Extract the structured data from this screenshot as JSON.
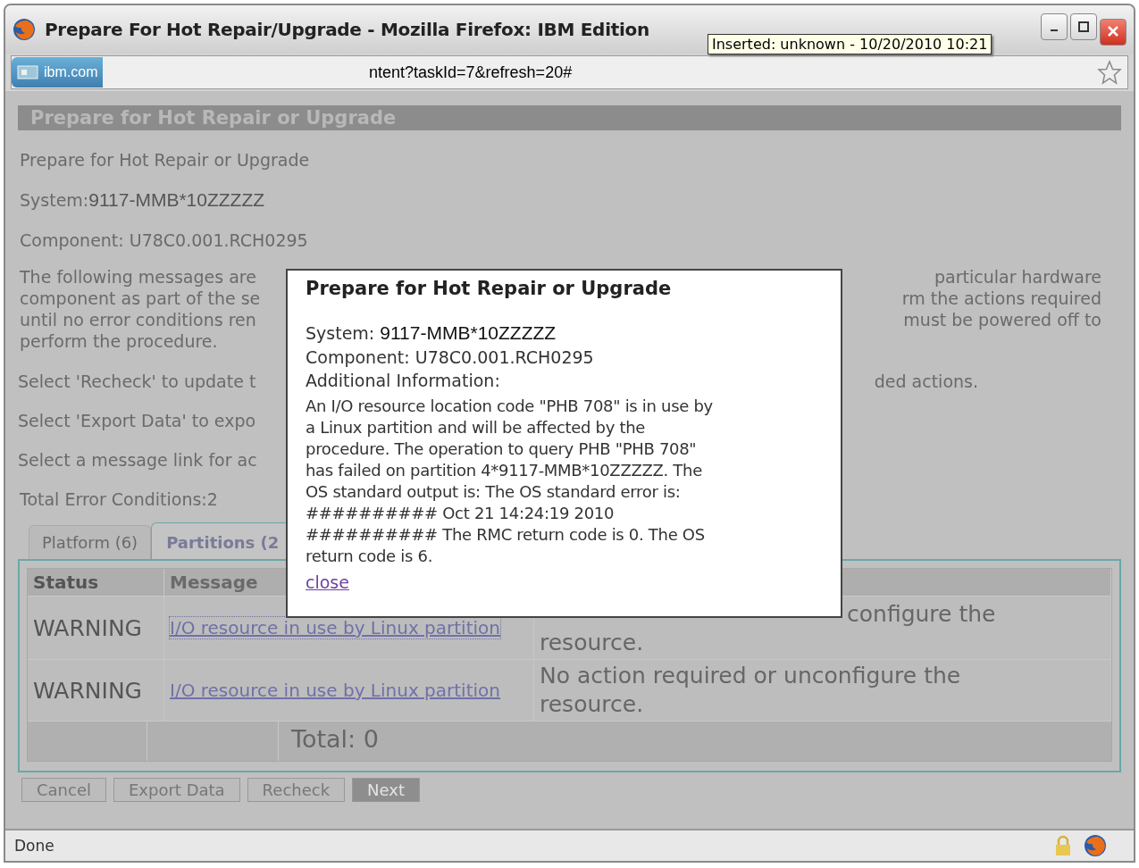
{
  "window": {
    "title": "Prepare For Hot Repair/Upgrade - Mozilla Firefox: IBM Edition",
    "tooltip": "Inserted: unknown - 10/20/2010 10:21"
  },
  "address_bar": {
    "site_badge": "ibm.com",
    "url": "ntent?taskId=7&refresh=20#"
  },
  "page": {
    "banner": "Prepare for Hot Repair or Upgrade",
    "heading": "Prepare for Hot Repair or Upgrade",
    "system_label": "System:",
    "system_value": "9117-MMB*10ZZZZZ",
    "component": "Component: U78C0.001.RCH0295",
    "intro_lines": [
      {
        "left": "The following messages are",
        "right": "particular hardware"
      },
      {
        "left": "component as part of the se",
        "right": "rm the actions required"
      },
      {
        "left": "until no error conditions ren",
        "right": "must be powered off to"
      },
      {
        "left": "perform the procedure."
      }
    ],
    "instructions": [
      {
        "left": "Select 'Recheck' to update t",
        "right": "ded actions."
      },
      {
        "left": "Select 'Export Data' to expo"
      },
      {
        "left": "Select a message link for ac"
      }
    ],
    "total_errors": "Total Error Conditions:2",
    "tabs": [
      {
        "label": "Platform (6)",
        "selected": false
      },
      {
        "label": "Partitions (2",
        "selected": true
      }
    ],
    "table": {
      "columns": [
        "Status",
        "Message"
      ],
      "rows": [
        {
          "status": "WARNING",
          "message": "I/O resource in use by Linux partition",
          "action": "configure the resource.",
          "focused": true
        },
        {
          "status": "WARNING",
          "message": "I/O resource in use by Linux partition",
          "action": "No action required or unconfigure the resource.",
          "focused": false
        }
      ],
      "total": "Total: 0"
    },
    "buttons": [
      {
        "label": "Cancel",
        "disabled": false
      },
      {
        "label": "Export Data",
        "disabled": false
      },
      {
        "label": "Recheck",
        "disabled": false
      },
      {
        "label": "Next",
        "disabled": true
      }
    ]
  },
  "dialog": {
    "title": "Prepare for Hot Repair or Upgrade",
    "system_label": "System:",
    "system_value": "9117-MMB*10ZZZZZ",
    "component": "Component: U78C0.001.RCH0295",
    "info_label": "Additional Information:",
    "message_lines": [
      "An I/O resource location code \"PHB 708\" is in use by",
      "a Linux partition and will be affected by the",
      "procedure. The operation to query PHB \"PHB 708\"",
      "has failed on partition 4*9117-MMB*10ZZZZZ. The",
      "OS standard output is: The OS standard error is:",
      "########## Oct 21 14:24:19 2010",
      "########## The RMC return code is 0. The OS",
      "return code is 6."
    ],
    "close_link": "close"
  },
  "status_bar": {
    "text": "Done"
  }
}
